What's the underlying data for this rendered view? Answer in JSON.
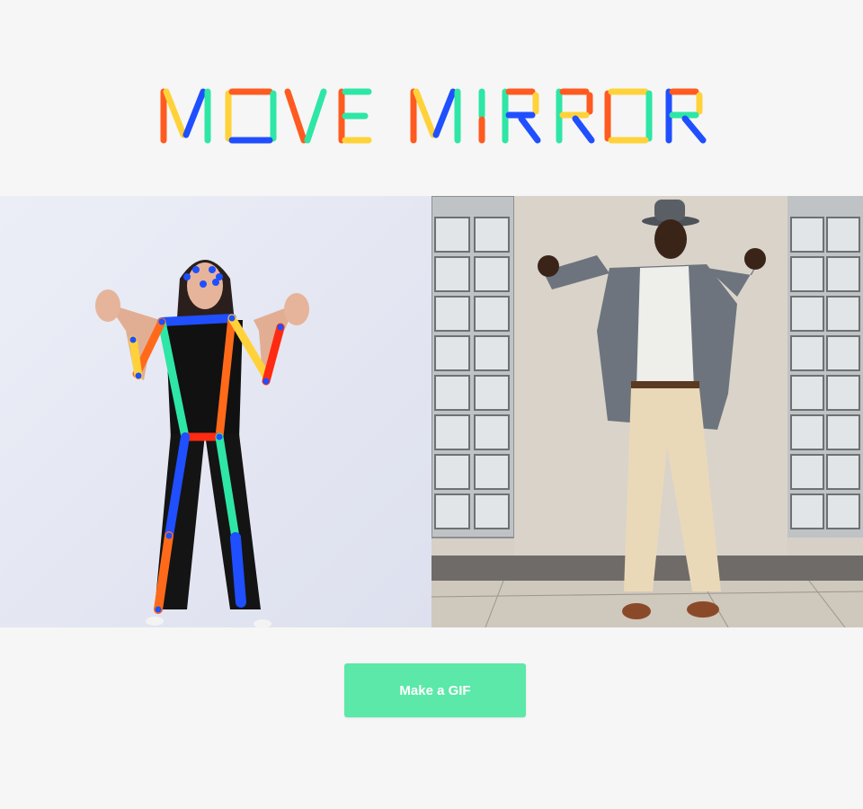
{
  "header": {
    "logo_text": "MOVE MIRROR"
  },
  "panels": {
    "left": {
      "image": "webcam-person-with-pose-skeleton"
    },
    "right": {
      "image": "matched-dancer-photo"
    }
  },
  "actions": {
    "make_gif_label": "Make a GIF"
  },
  "colors": {
    "background": "#f6f6f6",
    "button": "#5be8a8",
    "button_text": "#ffffff",
    "pose_blue": "#1f4fff",
    "pose_red": "#ff2a12",
    "pose_orange": "#ff6a1a",
    "pose_yellow": "#ffd23a",
    "pose_green": "#2ee6a6"
  }
}
